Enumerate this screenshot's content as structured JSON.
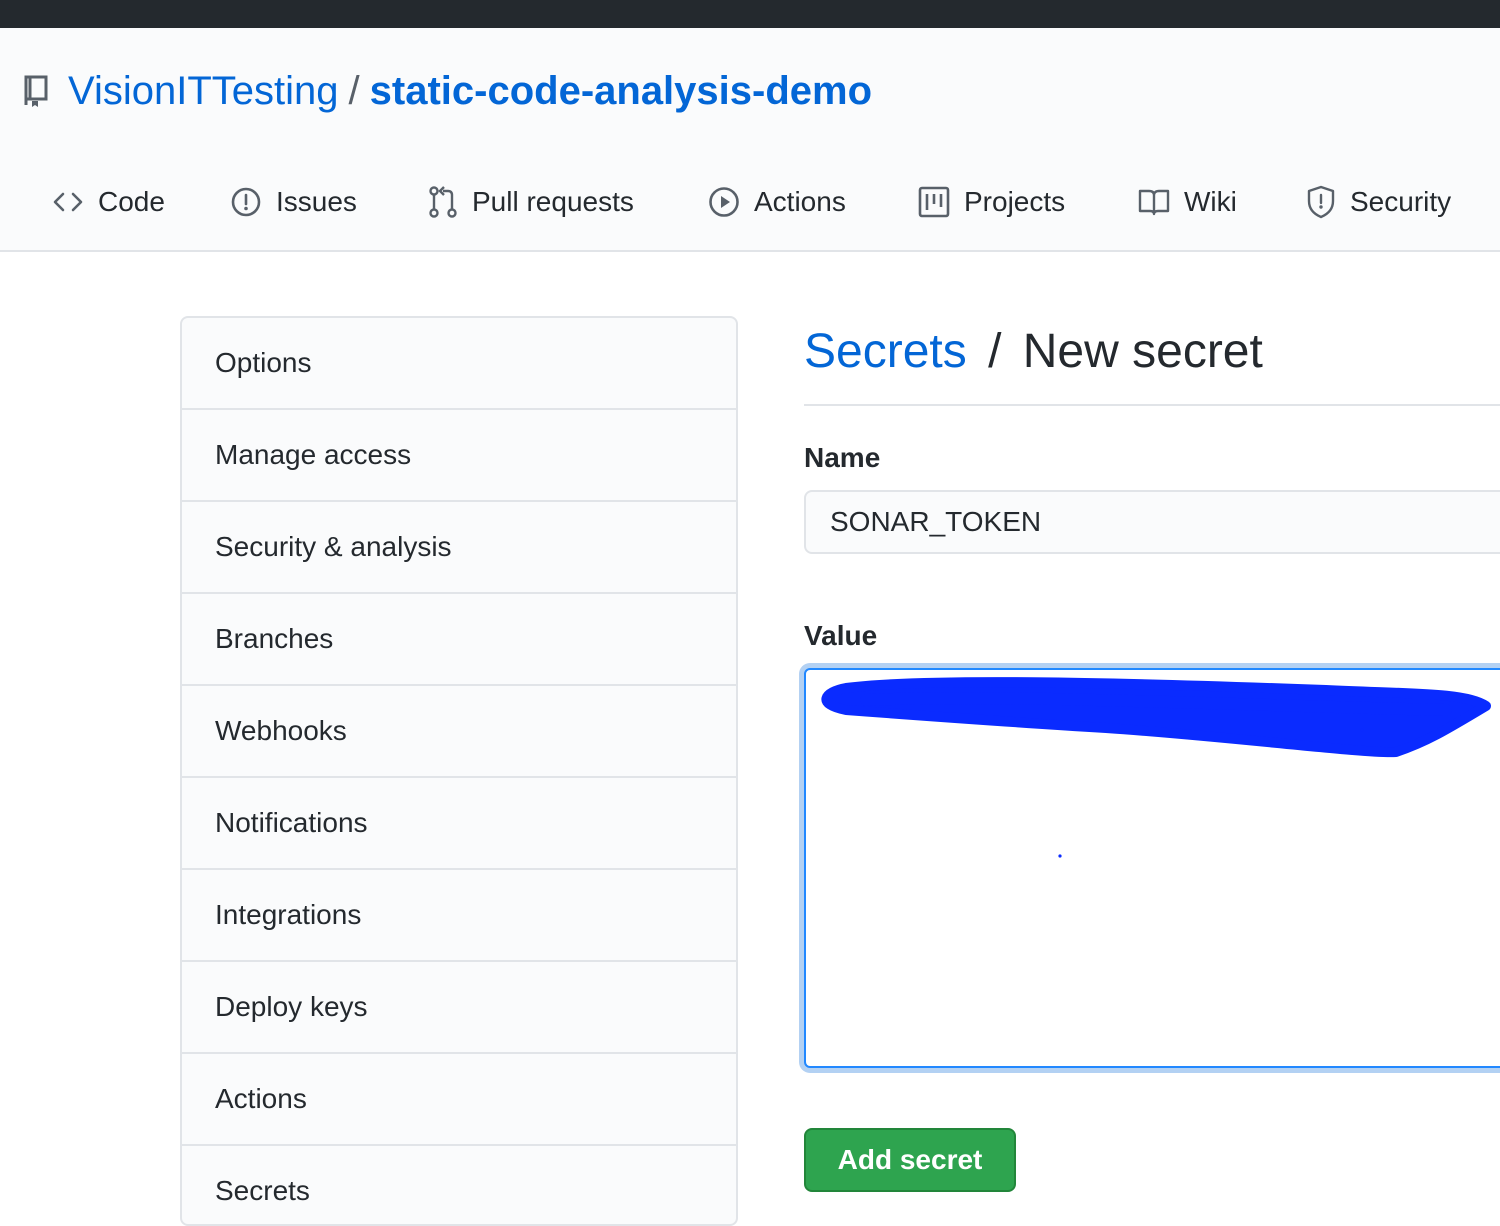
{
  "repo": {
    "owner": "VisionITTesting",
    "separator": "/",
    "name": "static-code-analysis-demo"
  },
  "tabs": [
    {
      "label": "Code",
      "icon": "code-icon"
    },
    {
      "label": "Issues",
      "icon": "issue-icon"
    },
    {
      "label": "Pull requests",
      "icon": "pull-request-icon"
    },
    {
      "label": "Actions",
      "icon": "play-icon"
    },
    {
      "label": "Projects",
      "icon": "project-icon"
    },
    {
      "label": "Wiki",
      "icon": "book-icon"
    },
    {
      "label": "Security",
      "icon": "shield-icon"
    }
  ],
  "sidebar": {
    "items": [
      {
        "label": "Options"
      },
      {
        "label": "Manage access"
      },
      {
        "label": "Security & analysis"
      },
      {
        "label": "Branches"
      },
      {
        "label": "Webhooks"
      },
      {
        "label": "Notifications"
      },
      {
        "label": "Integrations"
      },
      {
        "label": "Deploy keys"
      },
      {
        "label": "Actions"
      },
      {
        "label": "Secrets"
      }
    ]
  },
  "main": {
    "breadcrumb": "Secrets",
    "divider": "/",
    "title": "New secret",
    "name_label": "Name",
    "name_value": "SONAR_TOKEN",
    "value_label": "Value",
    "value_text": "",
    "value_redaction_color": "#0a2bff",
    "submit_label": "Add secret"
  },
  "colors": {
    "link": "#0366d6",
    "primary_button": "#2ea44f",
    "header_bar": "#24292e"
  }
}
